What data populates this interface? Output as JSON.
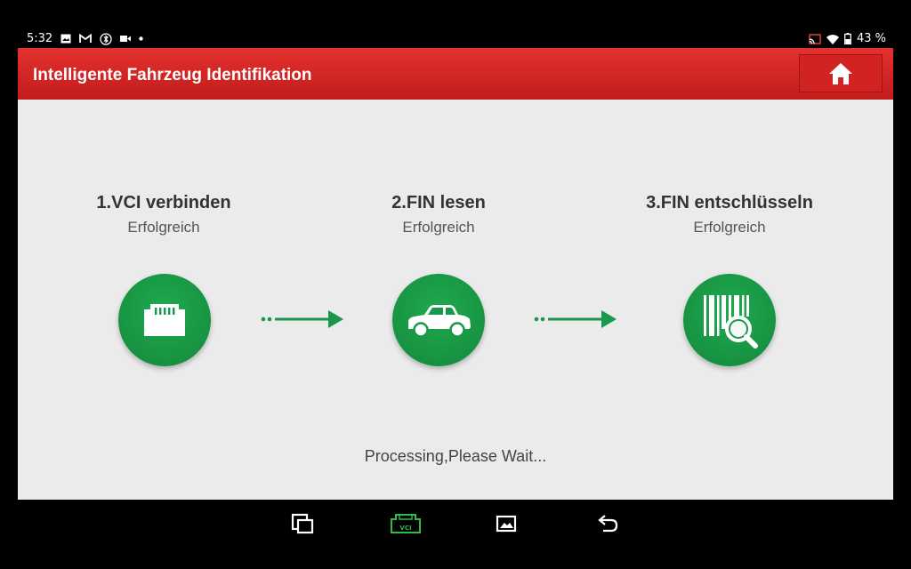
{
  "status_bar": {
    "time": "5:32",
    "battery": "43 %",
    "icons": [
      "image-icon",
      "gmail-icon",
      "bluetooth-icon",
      "video-icon",
      "dot-icon",
      "cast-icon",
      "wifi-icon",
      "battery-icon"
    ]
  },
  "header": {
    "title": "Intelligente Fahrzeug Identifikation",
    "home_icon": "home-icon"
  },
  "steps": [
    {
      "title": "1.VCI verbinden",
      "status": "Erfolgreich",
      "icon": "vci-connector-icon"
    },
    {
      "title": "2.FIN lesen",
      "status": "Erfolgreich",
      "icon": "car-icon"
    },
    {
      "title": "3.FIN entschlüsseln",
      "status": "Erfolgreich",
      "icon": "barcode-search-icon"
    }
  ],
  "processing_text": "Processing,Please Wait...",
  "nav_bar": {
    "icons": [
      "recent-apps-icon",
      "vci-icon",
      "gallery-icon",
      "back-icon"
    ],
    "vci_label": "VCI"
  },
  "colors": {
    "header_red": "#d12422",
    "step_green": "#18984a",
    "vci_active_green": "#2dbb4a"
  }
}
